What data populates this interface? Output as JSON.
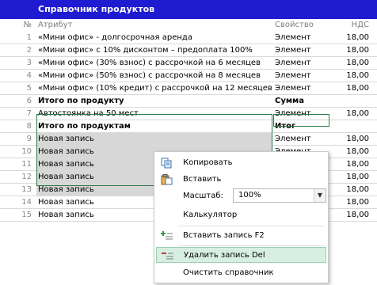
{
  "title": "Справочник продуктов",
  "columns": {
    "num": "№",
    "attr": "Атрибут",
    "prop": "Свойство",
    "vat": "НДС"
  },
  "rows": [
    {
      "num": "1",
      "attr": "«Мини офис» - долгосрочная аренда",
      "prop": "Элемент",
      "vat": "18,00"
    },
    {
      "num": "2",
      "attr": "«Мини офис» с 10% дисконтом – предоплата 100%",
      "prop": "Элемент",
      "vat": "18,00"
    },
    {
      "num": "3",
      "attr": "«Мини офис» (30% взнос) с рассрочкой на 6 месяцев",
      "prop": "Элемент",
      "vat": "18,00"
    },
    {
      "num": "4",
      "attr": "«Мини офис» (50% взнос) с рассрочкой на 8 месяцев",
      "prop": "Элемент",
      "vat": "18,00"
    },
    {
      "num": "5",
      "attr": "«Мини офис» (10% кредит) с рассрочкой на 12 месяцев",
      "prop": "Элемент",
      "vat": "18,00"
    },
    {
      "num": "6",
      "attr": "Итого по продукту",
      "prop": "Сумма",
      "vat": ""
    },
    {
      "num": "7",
      "attr": "Автостоянка на 50 мест",
      "prop": "Элемент",
      "vat": "18,00"
    },
    {
      "num": "8",
      "attr": "Итого по продуктам",
      "prop": "Итог",
      "vat": ""
    },
    {
      "num": "9",
      "attr": "Новая запись",
      "prop": "Элемент",
      "vat": "18,00"
    },
    {
      "num": "10",
      "attr": "Новая запись",
      "prop": "Элемент",
      "vat": "18,00"
    },
    {
      "num": "11",
      "attr": "Новая запись",
      "prop": "",
      "vat": "18,00"
    },
    {
      "num": "12",
      "attr": "Новая запись",
      "prop": "",
      "vat": "18,00"
    },
    {
      "num": "13",
      "attr": "Новая запись",
      "prop": "",
      "vat": "18,00"
    },
    {
      "num": "14",
      "attr": "Новая запись",
      "prop": "",
      "vat": "18,00"
    },
    {
      "num": "15",
      "attr": "Новая запись",
      "prop": "",
      "vat": "18,00"
    }
  ],
  "menu": {
    "copy": "Копировать",
    "paste": "Вставить",
    "zoom_label": "Масштаб:",
    "zoom_value": "100%",
    "calculator": "Калькулятор",
    "insert_record": "Вставить запись F2",
    "delete_record": "Удалить запись   Del",
    "clear": "Очистить справочник"
  },
  "colors": {
    "title_bar": "#1f1bd0",
    "selection": "#2a7a4a",
    "menu_hover": "#d7efe2"
  }
}
